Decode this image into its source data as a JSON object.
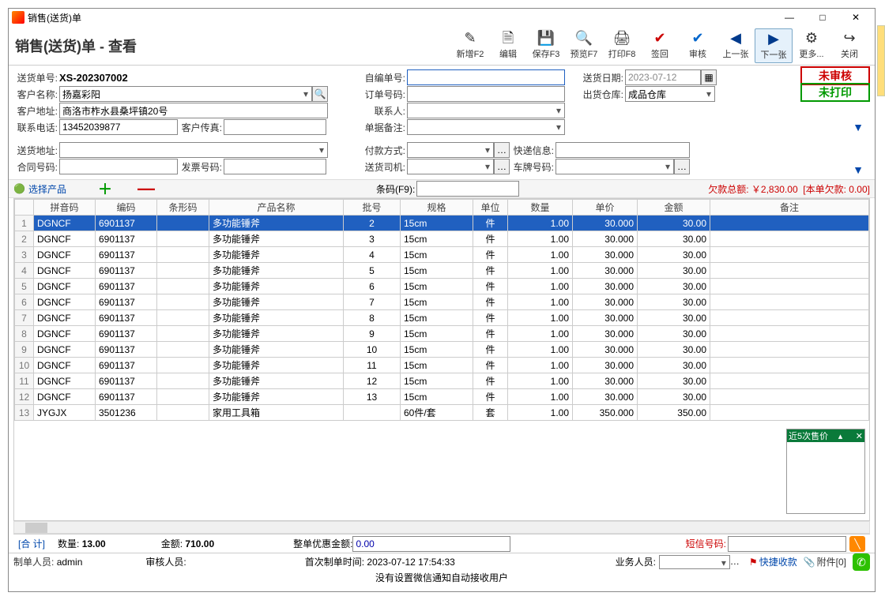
{
  "window_title": "销售(送货)单",
  "page_title": "销售(送货)单 - 查看",
  "toolbar": {
    "new": "新增F2",
    "edit": "编辑",
    "save": "保存F3",
    "preview": "预览F7",
    "print": "打印F8",
    "signin": "签回",
    "audit": "审核",
    "prev": "上一张",
    "next": "下一张",
    "more": "更多...",
    "close": "关闭"
  },
  "labels": {
    "delivery_no": "送货单号:",
    "custom_no": "自编单号:",
    "delivery_date": "送货日期:",
    "customer_name": "客户名称:",
    "order_no": "订单号码:",
    "out_warehouse": "出货仓库:",
    "customer_addr": "客户地址:",
    "contact": "联系人:",
    "phone": "联系电话:",
    "fax": "客户传真:",
    "remark": "单据备注:",
    "ship_addr": "送货地址:",
    "pay_method": "付款方式:",
    "express": "快递信息:",
    "contract_no": "合同号码:",
    "invoice_no": "发票号码:",
    "driver": "送货司机:",
    "plate": "车牌号码:",
    "select_product": "选择产品",
    "barcode": "条码(F9):",
    "arrears_label": "欠款总额:",
    "arrears_amount": "￥2,830.00",
    "arrears_this": "[本单欠款: 0.00]",
    "heji": "[合 计]",
    "qty": "数量:",
    "amount": "金额:",
    "discount": "整单优惠金额:",
    "sms": "短信号码:",
    "maker": "制单人员:",
    "auditor": "审核人员:",
    "first_time": "首次制单时间:",
    "biz": "业务人员:",
    "quickpay": "快捷收款",
    "attach": "附件[0]",
    "status": "没有设置微信通知自动接收用户"
  },
  "values": {
    "delivery_no": "XS-202307002",
    "customer_name": "扬嘉彩阳",
    "customer_addr": "商洛市柞水县桑坪镇20号",
    "phone": "13452039877",
    "fax": "",
    "custom_no": "",
    "order_no": "",
    "contact": "",
    "remark": "",
    "delivery_date": "2023-07-12",
    "out_warehouse": "成品仓库",
    "ship_addr": "",
    "pay_method": "",
    "express": "",
    "contract_no": "",
    "invoice_no": "",
    "driver": "",
    "plate": "",
    "barcode": "",
    "qty_total": "13.00",
    "amount_total": "710.00",
    "discount": "0.00",
    "sms": "",
    "maker": "admin",
    "auditor": "",
    "first_time": "2023-07-12 17:54:33",
    "biz": ""
  },
  "stamps": {
    "unaudited": "未审核",
    "unprinted": "未打印"
  },
  "columns": [
    "拼音码",
    "编码",
    "条形码",
    "产品名称",
    "批号",
    "规格",
    "单位",
    "数量",
    "单价",
    "金额",
    "备注"
  ],
  "rows": [
    {
      "py": "DGNCF",
      "code": "6901137",
      "bar": "",
      "name": "多功能锤斧",
      "batch": "2",
      "spec": "15cm",
      "unit": "件",
      "qty": "1.00",
      "price": "30.000",
      "amt": "30.00",
      "note": ""
    },
    {
      "py": "DGNCF",
      "code": "6901137",
      "bar": "",
      "name": "多功能锤斧",
      "batch": "3",
      "spec": "15cm",
      "unit": "件",
      "qty": "1.00",
      "price": "30.000",
      "amt": "30.00",
      "note": ""
    },
    {
      "py": "DGNCF",
      "code": "6901137",
      "bar": "",
      "name": "多功能锤斧",
      "batch": "4",
      "spec": "15cm",
      "unit": "件",
      "qty": "1.00",
      "price": "30.000",
      "amt": "30.00",
      "note": ""
    },
    {
      "py": "DGNCF",
      "code": "6901137",
      "bar": "",
      "name": "多功能锤斧",
      "batch": "5",
      "spec": "15cm",
      "unit": "件",
      "qty": "1.00",
      "price": "30.000",
      "amt": "30.00",
      "note": ""
    },
    {
      "py": "DGNCF",
      "code": "6901137",
      "bar": "",
      "name": "多功能锤斧",
      "batch": "6",
      "spec": "15cm",
      "unit": "件",
      "qty": "1.00",
      "price": "30.000",
      "amt": "30.00",
      "note": ""
    },
    {
      "py": "DGNCF",
      "code": "6901137",
      "bar": "",
      "name": "多功能锤斧",
      "batch": "7",
      "spec": "15cm",
      "unit": "件",
      "qty": "1.00",
      "price": "30.000",
      "amt": "30.00",
      "note": ""
    },
    {
      "py": "DGNCF",
      "code": "6901137",
      "bar": "",
      "name": "多功能锤斧",
      "batch": "8",
      "spec": "15cm",
      "unit": "件",
      "qty": "1.00",
      "price": "30.000",
      "amt": "30.00",
      "note": ""
    },
    {
      "py": "DGNCF",
      "code": "6901137",
      "bar": "",
      "name": "多功能锤斧",
      "batch": "9",
      "spec": "15cm",
      "unit": "件",
      "qty": "1.00",
      "price": "30.000",
      "amt": "30.00",
      "note": ""
    },
    {
      "py": "DGNCF",
      "code": "6901137",
      "bar": "",
      "name": "多功能锤斧",
      "batch": "10",
      "spec": "15cm",
      "unit": "件",
      "qty": "1.00",
      "price": "30.000",
      "amt": "30.00",
      "note": ""
    },
    {
      "py": "DGNCF",
      "code": "6901137",
      "bar": "",
      "name": "多功能锤斧",
      "batch": "11",
      "spec": "15cm",
      "unit": "件",
      "qty": "1.00",
      "price": "30.000",
      "amt": "30.00",
      "note": ""
    },
    {
      "py": "DGNCF",
      "code": "6901137",
      "bar": "",
      "name": "多功能锤斧",
      "batch": "12",
      "spec": "15cm",
      "unit": "件",
      "qty": "1.00",
      "price": "30.000",
      "amt": "30.00",
      "note": ""
    },
    {
      "py": "DGNCF",
      "code": "6901137",
      "bar": "",
      "name": "多功能锤斧",
      "batch": "13",
      "spec": "15cm",
      "unit": "件",
      "qty": "1.00",
      "price": "30.000",
      "amt": "30.00",
      "note": ""
    },
    {
      "py": "JYGJX",
      "code": "3501236",
      "bar": "",
      "name": "家用工具箱",
      "batch": "",
      "spec": "60件/套",
      "unit": "套",
      "qty": "1.00",
      "price": "350.000",
      "amt": "350.00",
      "note": ""
    }
  ],
  "panel_title": "近5次售价"
}
